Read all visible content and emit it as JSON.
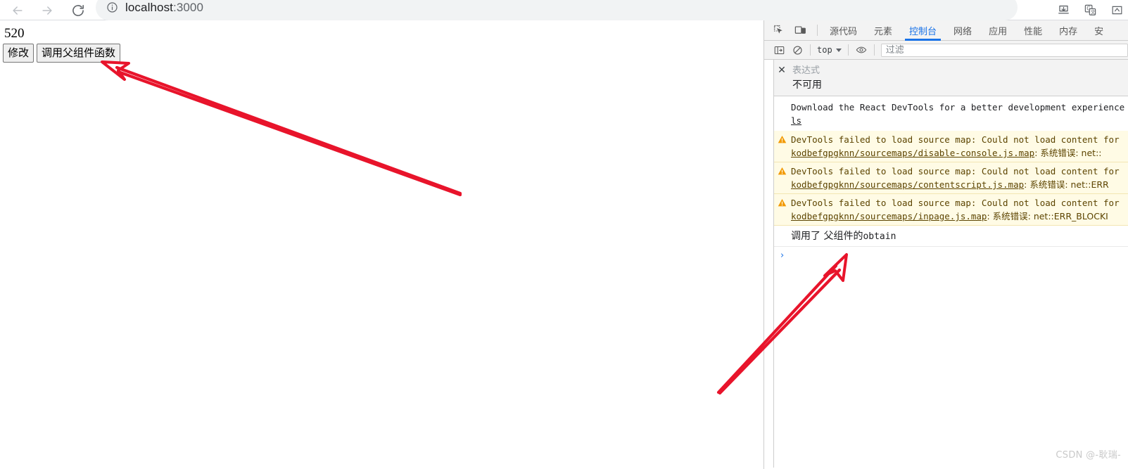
{
  "browser": {
    "back_icon": "arrow-left-icon",
    "forward_icon": "arrow-right-icon",
    "reload_icon": "reload-icon",
    "site_info_icon": "info-circle-icon",
    "url_host": "localhost",
    "url_port": ":3000",
    "toolbar_icons": [
      "download-icon",
      "google-translate-icon",
      "extension-icon"
    ]
  },
  "page": {
    "count_value": "520",
    "buttons": [
      {
        "label": "修改",
        "name": "modify-button"
      },
      {
        "label": "调用父组件函数",
        "name": "call-parent-function-button"
      }
    ]
  },
  "devtools": {
    "inspect_icon": "inspect-element-icon",
    "device_icon": "device-toolbar-icon",
    "tabs": [
      {
        "label": "源代码",
        "active": false
      },
      {
        "label": "元素",
        "active": false
      },
      {
        "label": "控制台",
        "active": true
      },
      {
        "label": "网络",
        "active": false
      },
      {
        "label": "应用",
        "active": false
      },
      {
        "label": "性能",
        "active": false
      },
      {
        "label": "内存",
        "active": false
      },
      {
        "label": "安",
        "active": false
      }
    ],
    "filterbar": {
      "sidebar_icon": "console-sidebar-icon",
      "clear_icon": "clear-console-icon",
      "context_label": "top",
      "eye_icon": "live-expression-eye-icon",
      "filter_placeholder": "过滤",
      "filter_value": ""
    },
    "live_expression": {
      "close_icon": "close-icon",
      "label": "表达式",
      "value": "不可用"
    },
    "messages": [
      {
        "type": "info",
        "line1": "Download the React DevTools for a better development experience",
        "line2": "ls"
      },
      {
        "type": "warning",
        "icon": "warning-triangle-icon",
        "line1": "DevTools failed to load source map: Could not load content for",
        "link": "kodbefgpgknn/sourcemaps/disable-console.js.map",
        "tail": ": 系统错误: net::"
      },
      {
        "type": "warning",
        "icon": "warning-triangle-icon",
        "line1": "DevTools failed to load source map: Could not load content for",
        "link": "kodbefgpgknn/sourcemaps/contentscript.js.map",
        "tail": ": 系统错误: net::ERR"
      },
      {
        "type": "warning",
        "icon": "warning-triangle-icon",
        "line1": "DevTools failed to load source map: Could not load content for",
        "link": "kodbefgpgknn/sourcemaps/inpage.js.map",
        "tail": ": 系统错误: net::ERR_BLOCKI"
      },
      {
        "type": "log",
        "text_cn": "调用了  父组件的",
        "text_mono": "obtain"
      }
    ],
    "prompt_symbol": "›"
  },
  "annotations": {
    "arrow_color": "#e8142b",
    "arrow1_name": "annotation-arrow-to-call-parent-button",
    "arrow2_name": "annotation-arrow-to-console-log"
  },
  "watermark": "CSDN @-耿瑞-"
}
